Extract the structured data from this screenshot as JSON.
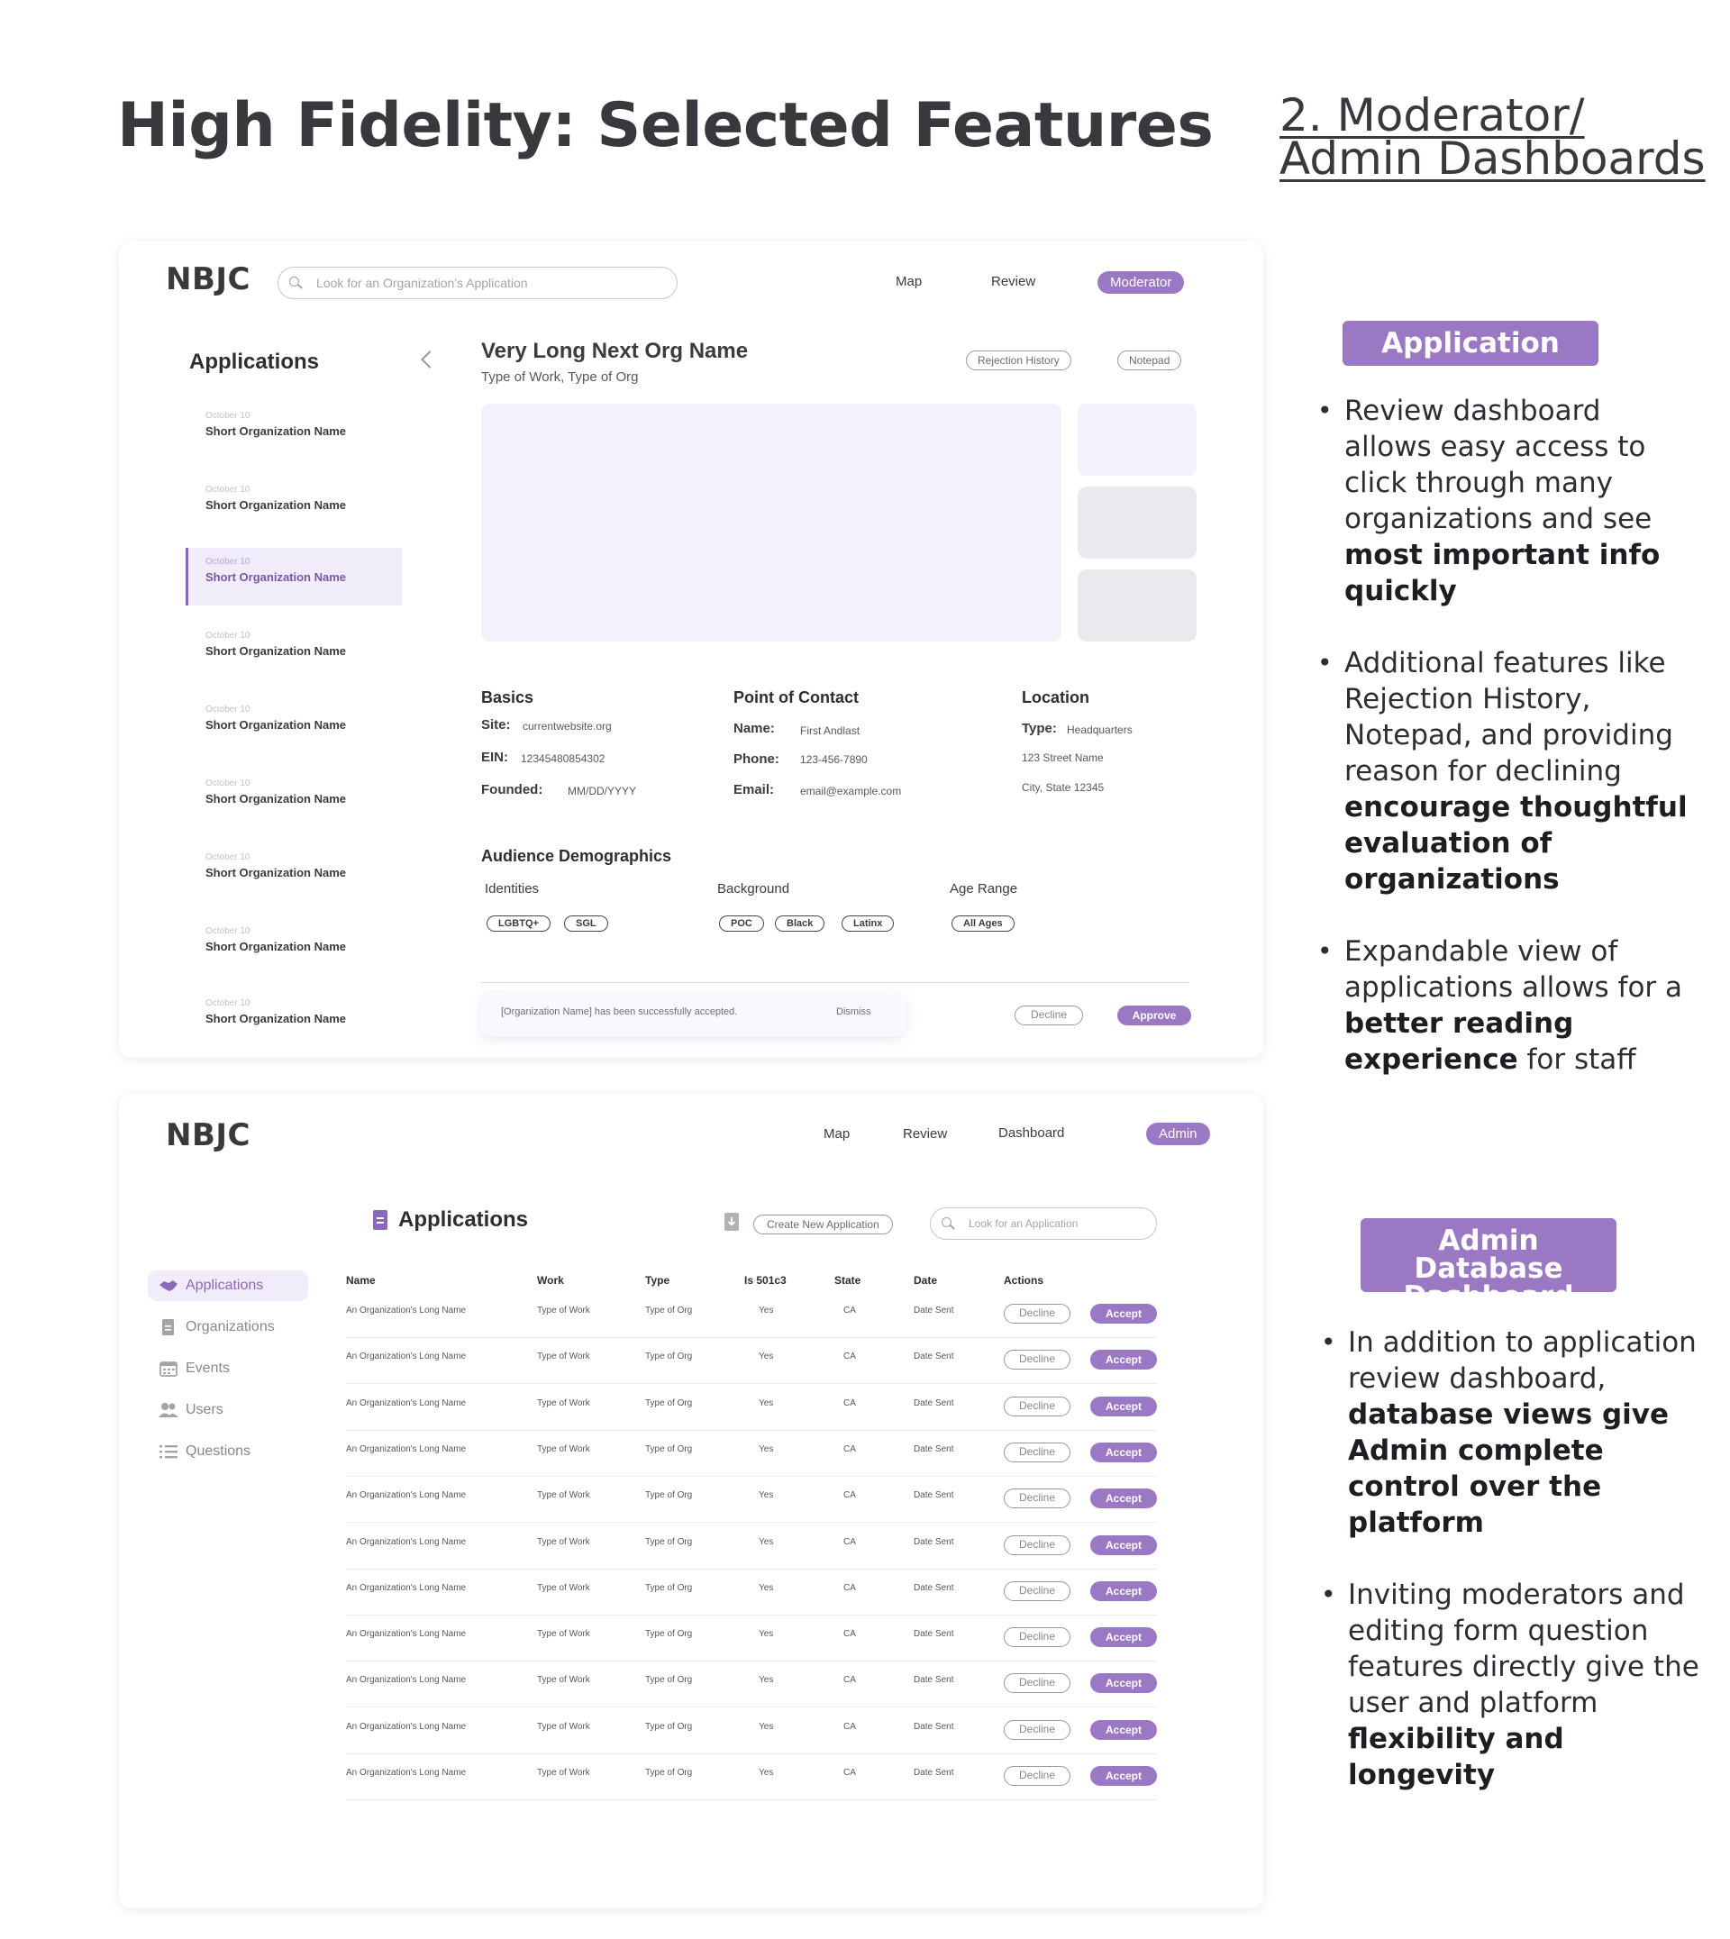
{
  "page": {
    "title": "High Fidelity: Selected Features",
    "section_link": "2. Moderator/ Admin Dashboards"
  },
  "moderator": {
    "logo": "NBJC",
    "search_placeholder": "Look for an Organization's Application",
    "nav": {
      "map": "Map",
      "review": "Review",
      "role": "Moderator"
    },
    "sidebar": {
      "heading": "Applications",
      "items": [
        {
          "date": "October 10",
          "name": "Short Organization Name"
        },
        {
          "date": "October 10",
          "name": "Short Organization Name"
        },
        {
          "date": "October 10",
          "name": "Short Organization Name",
          "selected": true
        },
        {
          "date": "October 10",
          "name": "Short Organization Name"
        },
        {
          "date": "October 10",
          "name": "Short Organization Name"
        },
        {
          "date": "October 10",
          "name": "Short Organization Name"
        },
        {
          "date": "October 10",
          "name": "Short Organization Name"
        },
        {
          "date": "October 10",
          "name": "Short Organization Name"
        },
        {
          "date": "October 10",
          "name": "Short Organization Name"
        }
      ]
    },
    "detail": {
      "org_name": "Very Long Next Org Name",
      "org_type": "Type of Work, Type of Org",
      "rejection_history": "Rejection History",
      "notepad": "Notepad",
      "basics": {
        "heading": "Basics",
        "site_label": "Site:",
        "site_value": "currentwebsite.org",
        "ein_label": "EIN:",
        "ein_value": "12345480854302",
        "founded_label": "Founded:",
        "founded_value": "MM/DD/YYYY"
      },
      "contact": {
        "heading": "Point of Contact",
        "name_label": "Name:",
        "name_value": "First Andlast",
        "phone_label": "Phone:",
        "phone_value": "123-456-7890",
        "email_label": "Email:",
        "email_value": "email@example.com"
      },
      "location": {
        "heading": "Location",
        "type_label": "Type:",
        "type_value": "Headquarters",
        "street": "123 Street Name",
        "city": "City, State 12345"
      },
      "demographics": {
        "heading": "Audience Demographics",
        "identities_label": "Identities",
        "identities": [
          "LGBTQ+",
          "SGL"
        ],
        "background_label": "Background",
        "background": [
          "POC",
          "Black",
          "Latinx"
        ],
        "age_label": "Age Range",
        "age": [
          "All Ages"
        ]
      },
      "toast": {
        "message": "[Organization Name] has been successfully accepted.",
        "dismiss": "Dismiss"
      },
      "decline": "Decline",
      "approve": "Approve"
    }
  },
  "admin": {
    "logo": "NBJC",
    "nav": {
      "map": "Map",
      "review": "Review",
      "dashboard": "Dashboard",
      "role": "Admin"
    },
    "sidebar": [
      "Applications",
      "Organizations",
      "Events",
      "Users",
      "Questions"
    ],
    "table_title": "Applications",
    "create_button": "Create New Application",
    "search_placeholder": "Look for an Application",
    "columns": [
      "Name",
      "Work",
      "Type",
      "Is 501c3",
      "State",
      "Date",
      "Actions"
    ],
    "rows": [
      {
        "name": "An Organization's Long Name",
        "work": "Type of Work",
        "type": "Type of Org",
        "is501c3": "Yes",
        "state": "CA",
        "date": "Date Sent"
      },
      {
        "name": "An Organization's Long Name",
        "work": "Type of Work",
        "type": "Type of Org",
        "is501c3": "Yes",
        "state": "CA",
        "date": "Date Sent"
      },
      {
        "name": "An Organization's Long Name",
        "work": "Type of Work",
        "type": "Type of Org",
        "is501c3": "Yes",
        "state": "CA",
        "date": "Date Sent"
      },
      {
        "name": "An Organization's Long Name",
        "work": "Type of Work",
        "type": "Type of Org",
        "is501c3": "Yes",
        "state": "CA",
        "date": "Date Sent"
      },
      {
        "name": "An Organization's Long Name",
        "work": "Type of Work",
        "type": "Type of Org",
        "is501c3": "Yes",
        "state": "CA",
        "date": "Date Sent"
      },
      {
        "name": "An Organization's Long Name",
        "work": "Type of Work",
        "type": "Type of Org",
        "is501c3": "Yes",
        "state": "CA",
        "date": "Date Sent"
      },
      {
        "name": "An Organization's Long Name",
        "work": "Type of Work",
        "type": "Type of Org",
        "is501c3": "Yes",
        "state": "CA",
        "date": "Date Sent"
      },
      {
        "name": "An Organization's Long Name",
        "work": "Type of Work",
        "type": "Type of Org",
        "is501c3": "Yes",
        "state": "CA",
        "date": "Date Sent"
      },
      {
        "name": "An Organization's Long Name",
        "work": "Type of Work",
        "type": "Type of Org",
        "is501c3": "Yes",
        "state": "CA",
        "date": "Date Sent"
      },
      {
        "name": "An Organization's Long Name",
        "work": "Type of Work",
        "type": "Type of Org",
        "is501c3": "Yes",
        "state": "CA",
        "date": "Date Sent"
      },
      {
        "name": "An Organization's Long Name",
        "work": "Type of Work",
        "type": "Type of Org",
        "is501c3": "Yes",
        "state": "CA",
        "date": "Date Sent"
      }
    ],
    "decline": "Decline",
    "accept": "Accept"
  },
  "notes": {
    "review_badge": "Application Review",
    "review_bullets": [
      [
        "Review dashboard allows easy access to click through many organizations and see ",
        "most important info quickly",
        ""
      ],
      [
        "Additional features like Rejection History, Notepad, and providing reason for declining ",
        "encourage thoughtful evaluation of organizations",
        ""
      ],
      [
        "Expandable view of applications allows for a ",
        "better reading experience",
        " for staff"
      ]
    ],
    "admin_badge": "Admin Database Dashboard",
    "admin_bullets": [
      [
        "In addition to application review dashboard, ",
        "database views give Admin complete control over the platform",
        ""
      ],
      [
        "Inviting moderators and editing form question features directly give the user and platform ",
        "flexibility and longevity",
        ""
      ]
    ]
  },
  "colors": {
    "accent": "#9b78c4",
    "accent_light": "#f1ecfa",
    "hero": "#f4f0fc",
    "text": "#3a383c"
  }
}
